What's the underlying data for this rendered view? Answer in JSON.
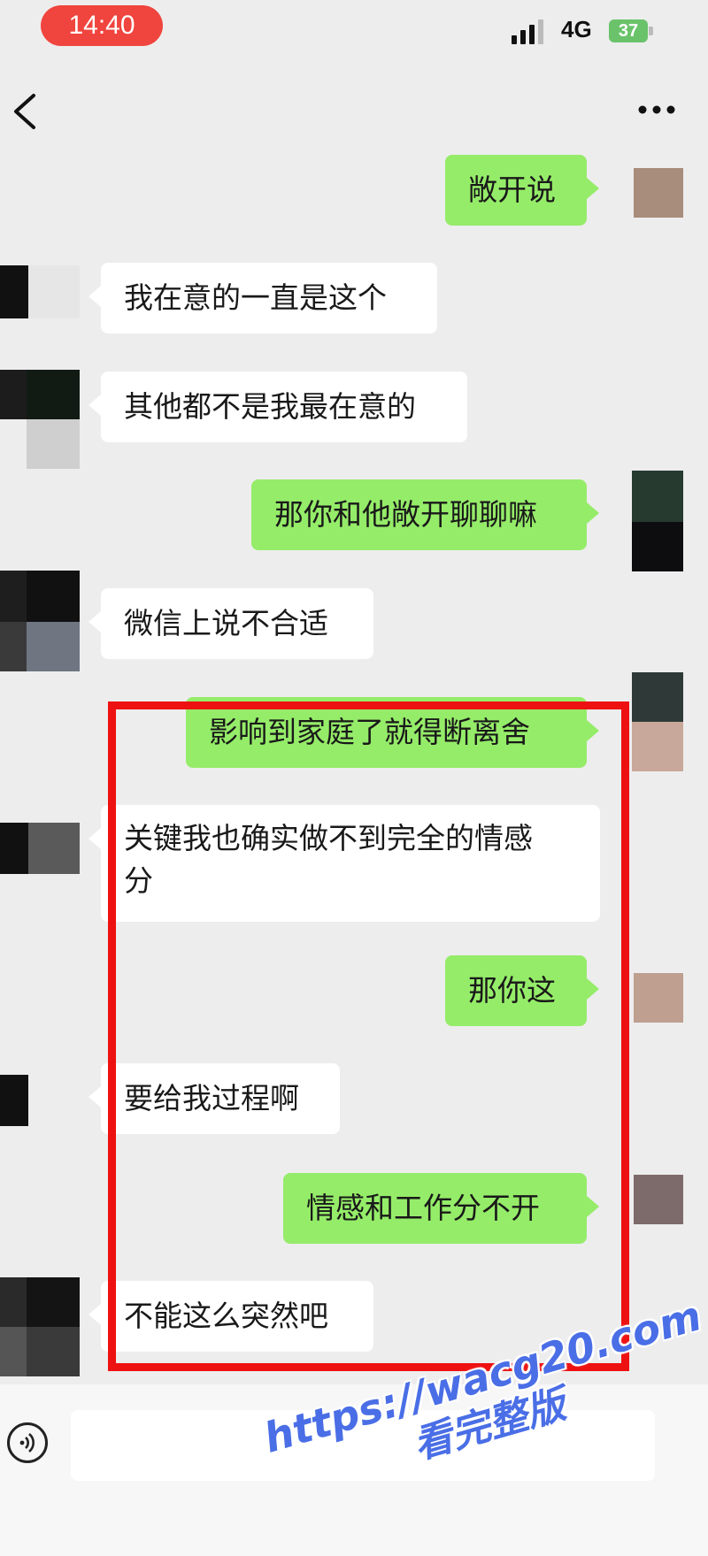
{
  "status_bar": {
    "time": "14:40",
    "network": "4G",
    "battery": "37"
  },
  "nav": {
    "back_icon": "chevron-left-icon",
    "more_icon": "more-dots-icon"
  },
  "messages": [
    {
      "side": "right",
      "text": "敞开说"
    },
    {
      "side": "left",
      "text": "我在意的一直是这个"
    },
    {
      "side": "left",
      "text": "其他都不是我最在意的"
    },
    {
      "side": "right",
      "text": "那你和他敞开聊聊嘛"
    },
    {
      "side": "left",
      "text": "微信上说不合适"
    },
    {
      "side": "right",
      "text": "影响到家庭了就得断离舍"
    },
    {
      "side": "left",
      "text": "关键我也确实做不到完全的情感分"
    },
    {
      "side": "right",
      "text": "那你这"
    },
    {
      "side": "left",
      "text": "要给我过程啊"
    },
    {
      "side": "right",
      "text": "情感和工作分不开"
    },
    {
      "side": "left",
      "text": "不能这么突然吧"
    }
  ],
  "multi_line": {
    "line1": "关键我也确实做不到完全的情感",
    "line2": "分"
  },
  "colors": {
    "sent_bubble": "#95ec69",
    "received_bubble": "#ffffff",
    "highlight_box": "#ee1111",
    "time_pill": "#f0443e",
    "watermark": "#4a6ee6"
  },
  "watermark": {
    "url": "https://wacg20.com",
    "title": "看完整版"
  }
}
